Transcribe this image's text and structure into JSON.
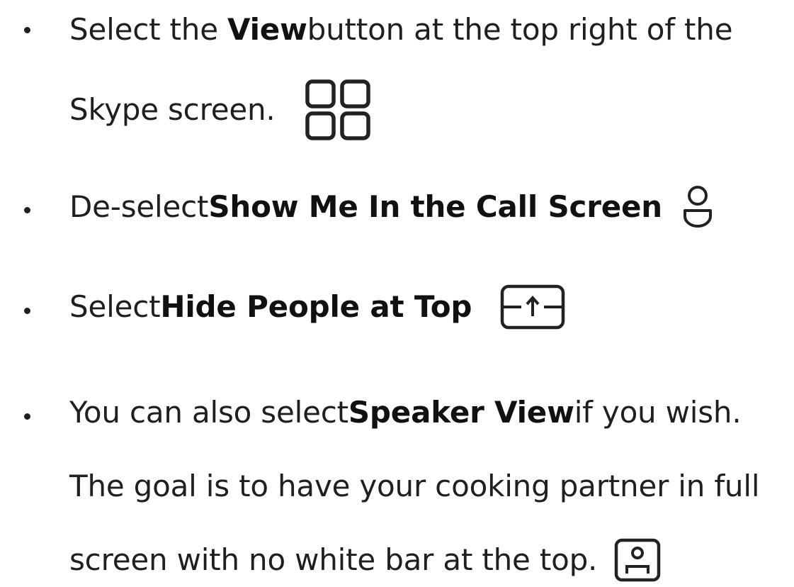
{
  "instructions": {
    "line1": {
      "prefix": "Select the ",
      "bold": "View",
      "suffix": " button at the top right of the"
    },
    "line2": {
      "text": "Skype screen.",
      "icon": "grid-view-icon"
    },
    "line3": {
      "prefix": "De-select ",
      "bold": "Show Me In the Call Screen",
      "icon": "person-icon"
    },
    "line4": {
      "prefix": "Select ",
      "bold": "Hide People at Top",
      "icon": "hide-people-top-icon"
    },
    "line5": {
      "prefix": "You can also select ",
      "bold": "Speaker View",
      "suffix": " if you wish."
    },
    "line6": {
      "text": "The goal is to have your cooking partner in full"
    },
    "line7": {
      "text": "screen with no white bar at the top.",
      "icon": "speaker-view-icon"
    }
  },
  "colors": {
    "text": "#1f1f1f",
    "icon": "#222222"
  }
}
